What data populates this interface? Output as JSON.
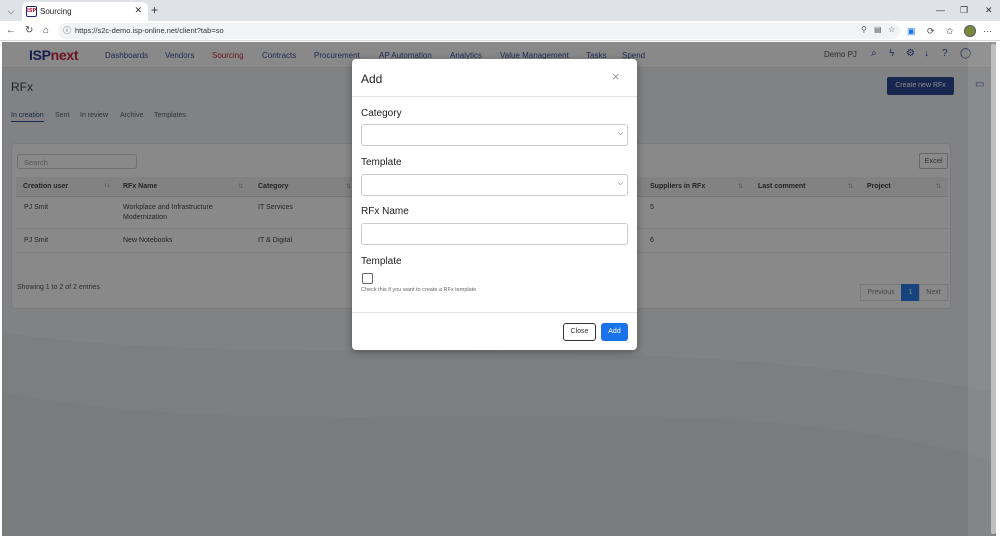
{
  "browser": {
    "tab_title": "Sourcing",
    "favicon_text": "ISP",
    "url": "https://s2c-demo.isp-online.net/client?tab=so"
  },
  "app": {
    "logo_isp": "ISP",
    "logo_next": "next",
    "nav": [
      "Dashboards",
      "Vendors",
      "Sourcing",
      "Contracts",
      "Procurement",
      "AP Automation",
      "Analytics",
      "Value Management",
      "Tasks",
      "Spend"
    ],
    "active_nav": "Sourcing",
    "user_name": "Demo PJ"
  },
  "page": {
    "title": "RFx",
    "create_button": "Create new RFx",
    "tabs": [
      "In creation",
      "Sent",
      "In review",
      "Archive",
      "Templates"
    ],
    "active_tab": "In creation",
    "search_placeholder": "Search",
    "excel_button": "Excel"
  },
  "table": {
    "columns": [
      "Creation user",
      "RFx Name",
      "Category",
      "Suppliers in RFx",
      "Last comment",
      "Project"
    ],
    "rows": [
      {
        "creation_user": "PJ Smit",
        "rfx_name_line1": "Workplace and Infrastructure",
        "rfx_name_line2": "Modernization",
        "category": "IT Services",
        "suppliers": "5"
      },
      {
        "creation_user": "PJ Smit",
        "rfx_name_line1": "New Notebooks",
        "rfx_name_line2": "",
        "category": "IT & Digital",
        "suppliers": "6"
      }
    ],
    "footer_info": "Showing 1 to 2 of 2 entries",
    "pagination": {
      "previous": "Previous",
      "current": "1",
      "next": "Next"
    }
  },
  "modal": {
    "title": "Add",
    "close_symbol": "×",
    "category_label": "Category",
    "category_value": "",
    "template_label": "Template",
    "template_value": "",
    "rfx_name_label": "RFx Name",
    "rfx_name_value": "",
    "template_checkbox_label": "Template",
    "template_checkbox_checked": false,
    "template_help": "Check this if you want to create a RFx template",
    "close_button": "Close",
    "add_button": "Add"
  },
  "colors": {
    "brand_navy": "#1a2a8c",
    "brand_red": "#c8102e",
    "primary_button": "#1a73e8",
    "create_button": "#1a3a8c"
  },
  "icons": [
    "tab-list-icon",
    "favicon",
    "close-tab-icon",
    "new-tab-icon",
    "minimize-icon",
    "maximize-icon",
    "close-window-icon",
    "back-icon",
    "refresh-icon",
    "home-icon",
    "site-info-icon",
    "zoom-icon",
    "reader-icon",
    "favorite-icon",
    "extension-icon",
    "collections-icon",
    "favorites-icon",
    "profile-icon",
    "search-icon",
    "lightning-icon",
    "settings-icon",
    "download-icon",
    "help-icon",
    "user-icon",
    "chat-icon"
  ]
}
